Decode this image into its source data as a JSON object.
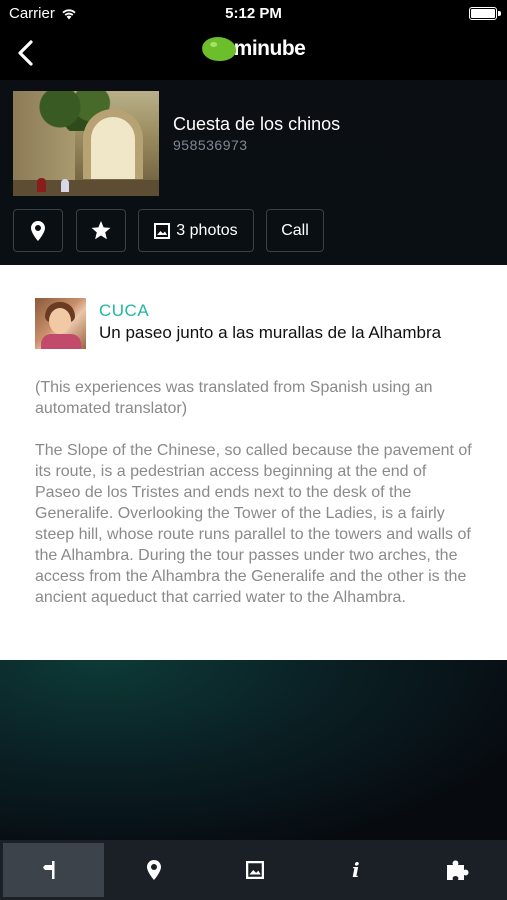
{
  "status_bar": {
    "carrier": "Carrier",
    "time": "5:12 PM"
  },
  "nav": {
    "logo_text": "minube",
    "back_icon": "chevron-left-icon"
  },
  "place": {
    "name": "Cuesta de los chinos",
    "phone": "958536973"
  },
  "actions": {
    "map_icon": "map-pin-icon",
    "favorite_icon": "star-icon",
    "photos_label": "3 photos",
    "call_label": "Call"
  },
  "review": {
    "author": "CUCA",
    "title": "Un paseo junto a las murallas de la Alhambra",
    "translated_note": "(This experiences was translated from Spanish using an automated translator)",
    "body": "The Slope of the Chinese, so called because the pavement of its route, is a pedestrian access beginning at the end of Paseo de los Tristes and ends next to the desk of the Generalife. Overlooking the Tower of the Ladies, is a fairly steep hill, whose route runs parallel to the towers and walls of the Alhambra. During the tour passes under two arches, the access from the Alhambra the Generalife and the other is the ancient aqueduct that carried water to the Alhambra."
  },
  "tabs": [
    {
      "icon": "signpost-icon",
      "active": true
    },
    {
      "icon": "map-pin-icon",
      "active": false
    },
    {
      "icon": "photo-icon",
      "active": false
    },
    {
      "icon": "info-icon",
      "glyph": "i",
      "active": false
    },
    {
      "icon": "puzzle-icon",
      "active": false
    }
  ],
  "colors": {
    "accent": "#21b7a0",
    "brand_green": "#6cbf2a",
    "tab_bar": "#1b2026",
    "header_bg": "#0b0f14"
  }
}
